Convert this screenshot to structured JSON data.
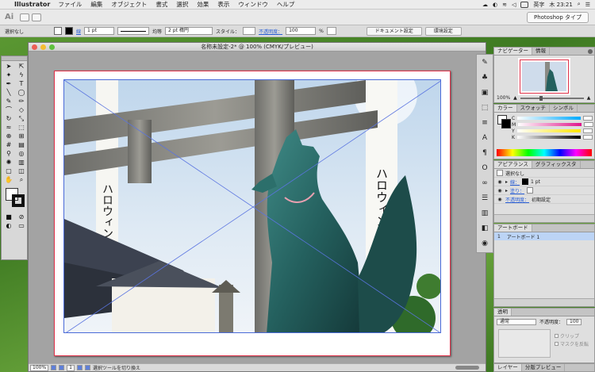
{
  "menubar": {
    "app_name": "Illustrator",
    "items": [
      "ファイル",
      "編集",
      "オブジェクト",
      "書式",
      "選択",
      "効果",
      "表示",
      "ウィンドウ",
      "ヘルプ"
    ],
    "ime": "英字",
    "clock": "木 23:21"
  },
  "appbar": {
    "logo": "Ai",
    "workspace": "Photoshop タイプ"
  },
  "controlbar": {
    "selection": "選択なし",
    "stroke_label": "線",
    "stroke_weight": "1 pt",
    "stroke_style": "均等",
    "brush": "2 pt 楕円",
    "style_label": "スタイル：",
    "opacity_label": "不透明度：",
    "opacity_value": "100",
    "opacity_unit": "%",
    "doc_setup": "ドキュメント設定",
    "prefs": "環境設定"
  },
  "document": {
    "title": "名称未設定-2* @ 100% (CMYK/プレビュー)"
  },
  "statusbar": {
    "zoom": "100%",
    "page": "1",
    "status": "選択ツールを切り換え"
  },
  "panels": {
    "navigator": {
      "tabs": [
        "ナビゲーター",
        "情報"
      ],
      "zoom": "100%"
    },
    "color": {
      "tabs": [
        "カラー",
        "スウォッチ",
        "シンボル"
      ],
      "channels": [
        "C",
        "M",
        "Y",
        "K"
      ]
    },
    "appearance": {
      "tabs": [
        "アピアランス",
        "グラフィックスタ"
      ],
      "header": "選択なし",
      "stroke_label": "線：",
      "stroke_value": "1 pt",
      "fill_label": "塗り：",
      "opacity_label": "不透明度：",
      "opacity_value": "初期設定"
    },
    "artboards": {
      "tabs": [
        "アートボード"
      ],
      "rows": [
        {
          "index": "1",
          "name": "アートボード 1"
        }
      ]
    },
    "transparency": {
      "tabs": [
        "透明"
      ],
      "blend_mode": "通常",
      "opacity_label": "不透明度：",
      "opacity_value": "100",
      "clip_label": "クリップ",
      "invert_label": "マスクを反転"
    },
    "layers": {
      "tabs": [
        "レイヤー",
        "分版プレビュー"
      ]
    }
  },
  "photo": {
    "banner_left_text": "ハロウィン 祭",
    "banner_right_text": "ハロウィン 半田市 祭"
  }
}
